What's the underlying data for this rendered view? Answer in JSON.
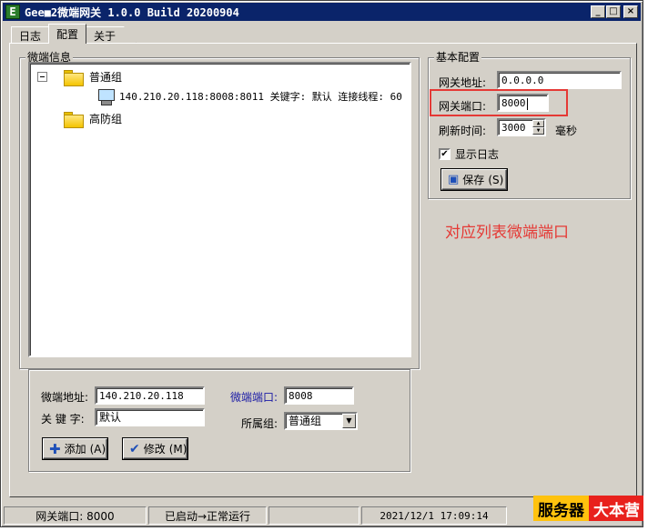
{
  "window": {
    "title": "Gee■2微端网关 1.0.0 Build 20200904",
    "icon_letter": "E"
  },
  "title_buttons": {
    "minimize": "_",
    "maximize": "□",
    "close": "×"
  },
  "tabs": [
    {
      "label": "日志",
      "active": false
    },
    {
      "label": "配置",
      "active": true
    },
    {
      "label": "关于",
      "active": false
    }
  ],
  "tree_group": {
    "title": "微端信息",
    "nodes": [
      {
        "label": "普通组"
      },
      {
        "label": "140.210.20.118:8008:8011 关键字: 默认 连接线程: 60"
      },
      {
        "label": "高防组"
      }
    ]
  },
  "edit_form": {
    "address_label": "微端地址:",
    "address_value": "140.210.20.118",
    "keyword_label": "关 键 字:",
    "keyword_value": "默认",
    "port_label": "微端端口:",
    "port_value": "8008",
    "group_label": "所属组:",
    "group_value": "普通组",
    "add_label": "添加",
    "add_hotkey": "(A)",
    "edit_label": "修改",
    "edit_hotkey": "(M)"
  },
  "basic_config": {
    "title": "基本配置",
    "gw_address_label": "网关地址:",
    "gw_address_value": "0.0.0.0",
    "gw_port_label": "网关端口:",
    "gw_port_value": "8000",
    "refresh_label": "刷新时间:",
    "refresh_value": "3000",
    "refresh_unit": "毫秒",
    "show_log_label": "显示日志",
    "show_log_checked": "✔",
    "save_label": "保存",
    "save_hotkey": "(S)"
  },
  "annotation": {
    "text": "对应列表微端端口",
    "color": "#e53935"
  },
  "statusbar": {
    "gateway_port": "网关端口: 8000",
    "status": "已启动→正常运行",
    "empty": "",
    "datetime": "2021/12/1 17:09:14"
  },
  "watermark": {
    "part1": "服务器",
    "part2": "大本营"
  }
}
